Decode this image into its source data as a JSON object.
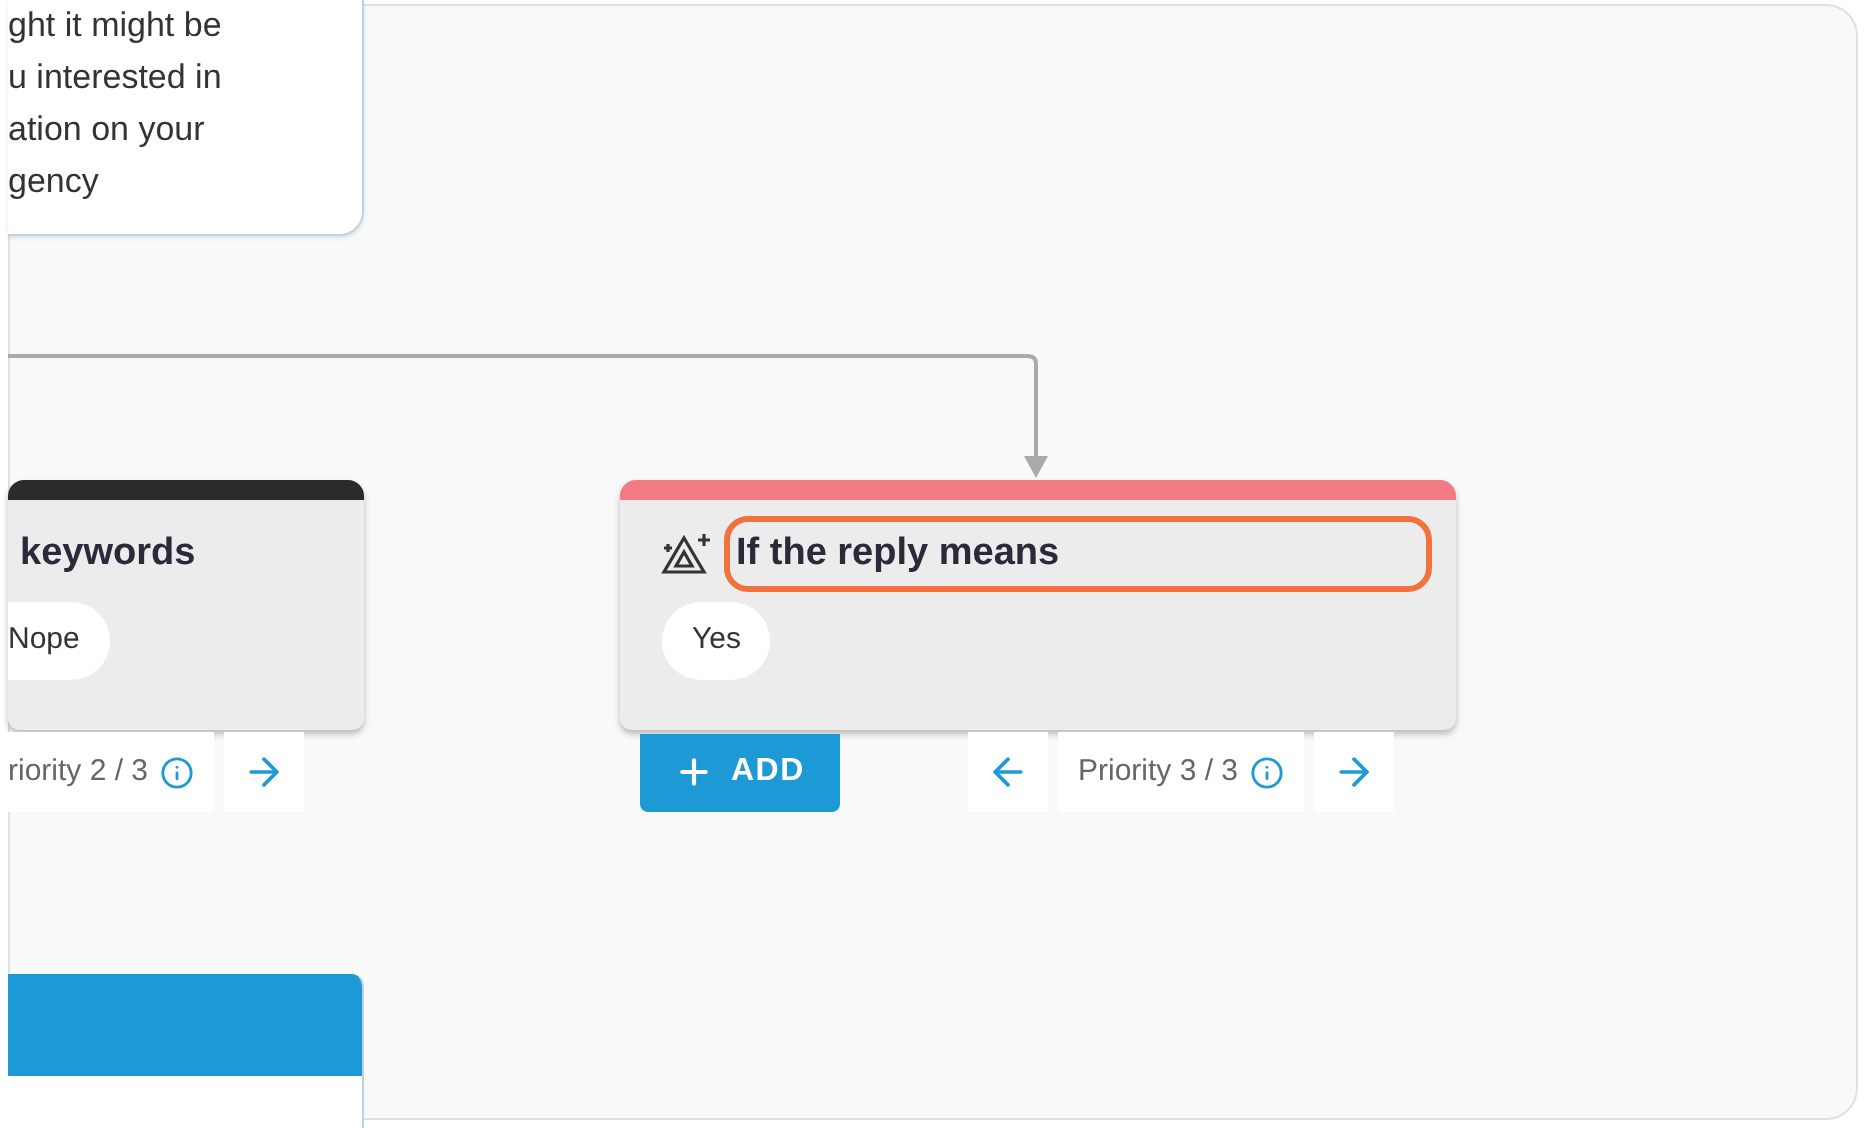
{
  "message_card": {
    "lines": [
      "ght it might be",
      "u interested in",
      "ation on your",
      "gency"
    ]
  },
  "nodes": [
    {
      "kind": "keywords",
      "title": "keywords",
      "color": "#2b2b2b",
      "highlighted": false,
      "options": [
        "Nope"
      ],
      "priority": "riority 2 / 3"
    },
    {
      "kind": "meaning",
      "title": "If the reply means",
      "color": "#f27b83",
      "highlighted": true,
      "options": [
        "Yes"
      ],
      "priority": "Priority 3 / 3",
      "add_label": "ADD"
    }
  ],
  "bottom_card": {
    "color": "#1d9ad6"
  }
}
